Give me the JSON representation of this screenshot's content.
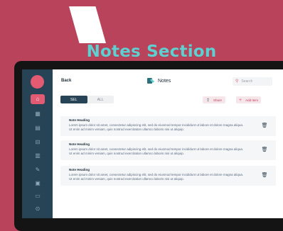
{
  "promo": {
    "title": "Notes Section"
  },
  "sidebar": {
    "items": [
      {
        "icon": "basket-icon",
        "glyph": "⌂",
        "active": true
      },
      {
        "icon": "calendar-icon",
        "glyph": "▦",
        "active": false
      },
      {
        "icon": "document-icon",
        "glyph": "▤",
        "active": false
      },
      {
        "icon": "report-icon",
        "glyph": "⊟",
        "active": false
      },
      {
        "icon": "files-icon",
        "glyph": "▥",
        "active": false
      },
      {
        "icon": "edit-icon",
        "glyph": "✎",
        "active": false
      },
      {
        "icon": "clipboard-icon",
        "glyph": "▣",
        "active": false
      },
      {
        "icon": "inbox-icon",
        "glyph": "▭",
        "active": false
      },
      {
        "icon": "settings-icon",
        "glyph": "⊙",
        "active": false
      }
    ]
  },
  "header": {
    "back_label": "Back",
    "title": "Notes",
    "search_placeholder": "Search"
  },
  "toolbar": {
    "toggle": [
      "SEL",
      "ALL"
    ],
    "share_label": "Share",
    "add_label": "Add Item"
  },
  "notes": [
    {
      "heading": "Note Heading",
      "body": "Lorem ipsum dolor sit amet, consectetur adipiscing elit, sed do eiusmod tempor incididunt ut labore et  dolore magna aliqua. Ut enim ad minim veniam, quis nostrud exercitation ullamco laboris nisi ut aliquip."
    },
    {
      "heading": "Note Heading",
      "body": "Lorem ipsum dolor sit amet, consectetur adipiscing elit, sed do eiusmod tempor incididunt ut labore et  dolore magna aliqua. Ut enim ad minim veniam, quis nostrud exercitation ullamco laboris nisi ut aliquip."
    },
    {
      "heading": "Note Heading",
      "body": "Lorem ipsum dolor sit amet, consectetur adipiscing elit, sed do eiusmod tempor incididunt ut labore et  dolore magna aliqua. Ut enim ad minim veniam, quis nostrud exercitation ullamco laboris nisi ut aliquip."
    }
  ],
  "colors": {
    "background": "#b8435b",
    "sidebar": "#274456",
    "accent": "#e35a73",
    "promo_title": "#5fcfd0"
  }
}
